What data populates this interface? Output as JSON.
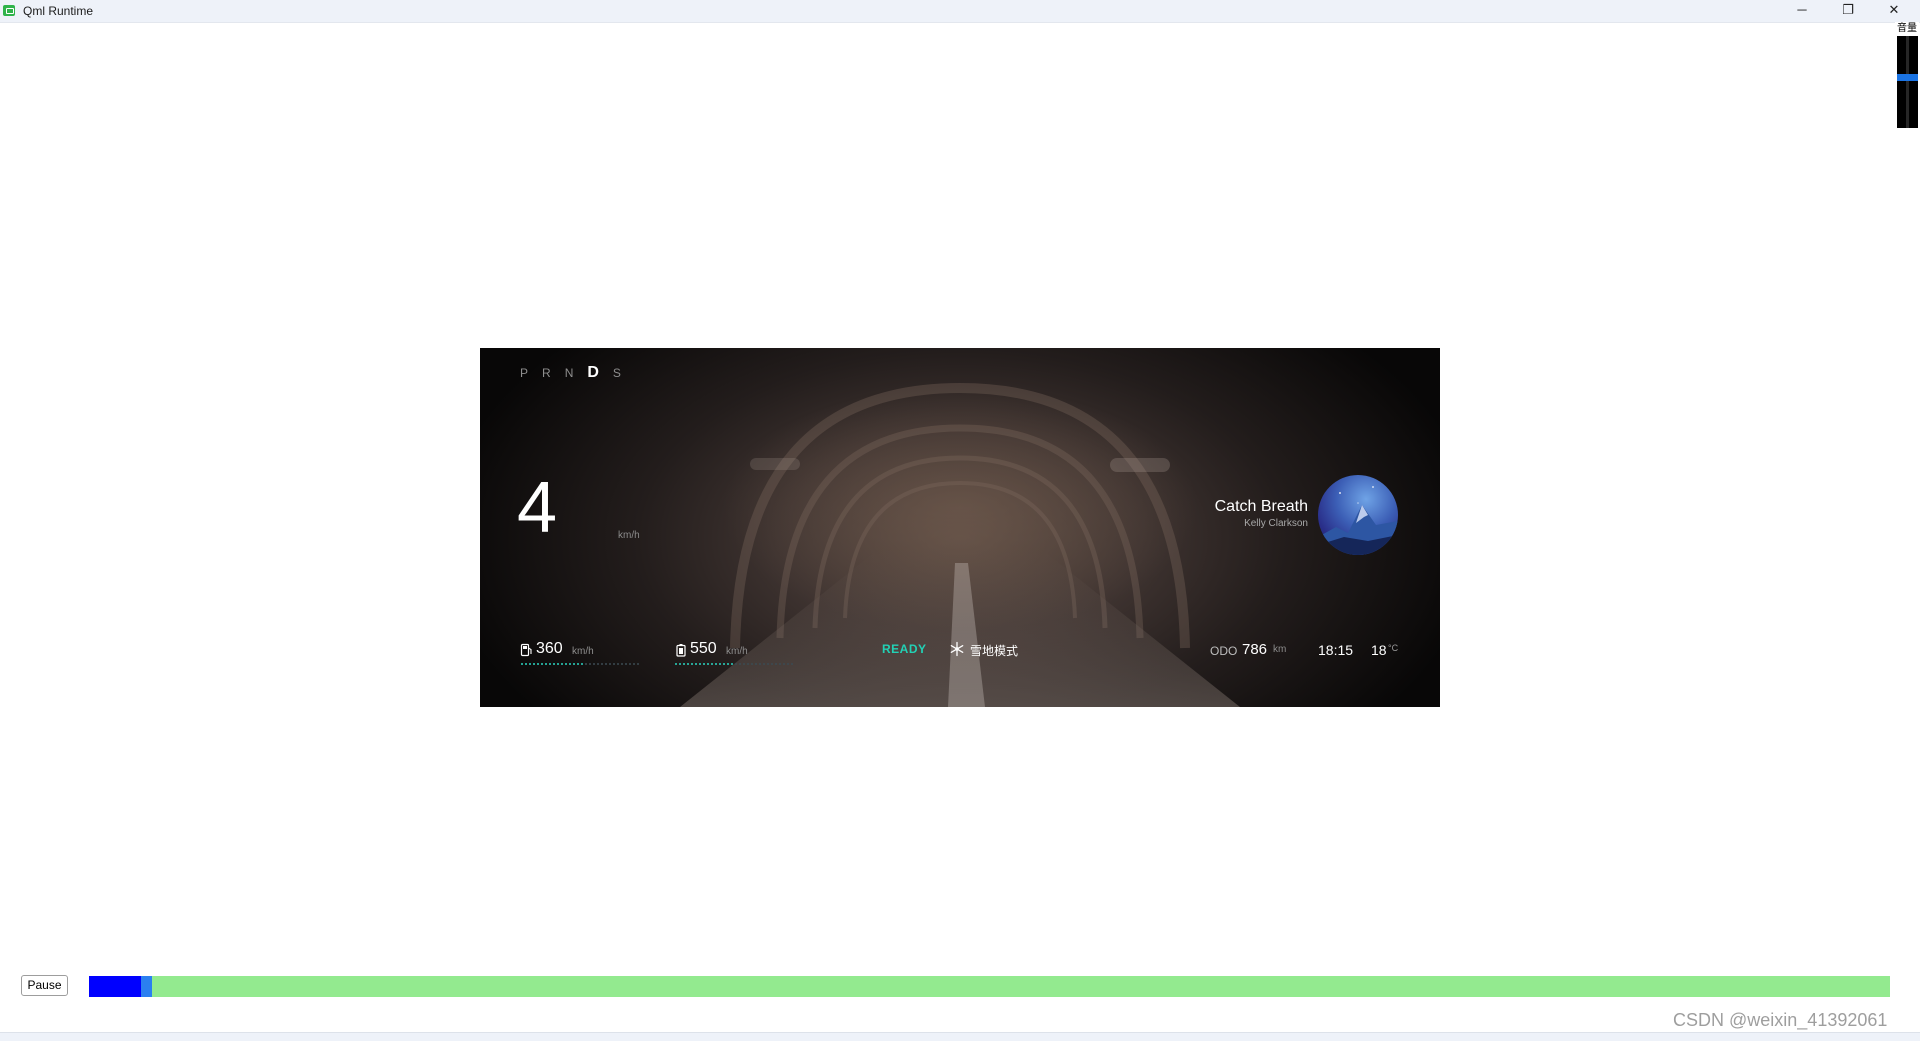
{
  "window": {
    "title": "Qml Runtime",
    "controls": {
      "minimize": "─",
      "maximize": "❐",
      "close": "✕"
    }
  },
  "volume": {
    "label": "音量",
    "level": 0.55,
    "accent_color": "#1b74e4"
  },
  "dashboard": {
    "gears": [
      {
        "label": "P",
        "active": false
      },
      {
        "label": "R",
        "active": false
      },
      {
        "label": "N",
        "active": false
      },
      {
        "label": "D",
        "active": true
      },
      {
        "label": "S",
        "active": false
      }
    ],
    "speed": {
      "value": "4",
      "unit": "km/h"
    },
    "music": {
      "title": "Catch Breath",
      "artist": "Kelly Clarkson"
    },
    "range_fuel": {
      "value": "360",
      "unit": "km/h",
      "icon": "fuel-pump-icon"
    },
    "range_battery": {
      "value": "550",
      "unit": "km/h",
      "icon": "battery-icon"
    },
    "status": {
      "ready": "READY",
      "ready_color": "#22d1b5",
      "mode": "雪地模式",
      "mode_icon": "snowflake-icon"
    },
    "odometer": {
      "label": "ODO",
      "value": "786",
      "unit": "km"
    },
    "clock": "18:15",
    "temperature": {
      "value": "18",
      "unit": "°C"
    }
  },
  "playback": {
    "pause_label": "Pause",
    "progress": 0.029,
    "track_color": "#93ea8f",
    "fill_color": "#0000ff",
    "handle_color": "#2b7ff0"
  },
  "watermark": "CSDN @weixin_41392061"
}
